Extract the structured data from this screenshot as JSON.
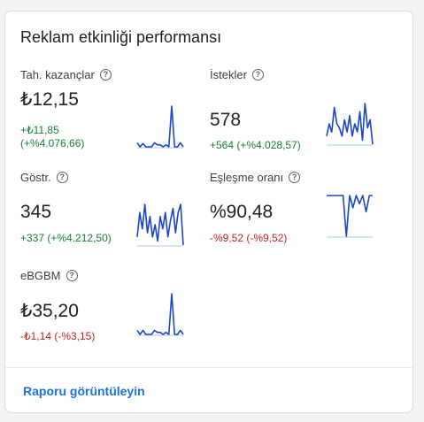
{
  "card": {
    "title": "Reklam etkinliği performansı",
    "footer_link": "Raporu görüntüleyin"
  },
  "help_glyph": "?",
  "metrics": [
    {
      "label": "Tah. kazançlar",
      "value": "₺12,15",
      "change_line1": "+₺11,85",
      "change_line2": "(+%4.076,66)",
      "trend": "positive"
    },
    {
      "label": "İstekler",
      "value": "578",
      "change_line1": "+564 (+%4.028,57)",
      "change_line2": "",
      "trend": "positive"
    },
    {
      "label": "Göstr.",
      "value": "345",
      "change_line1": "+337 (+%4.212,50)",
      "change_line2": "",
      "trend": "positive"
    },
    {
      "label": "Eşleşme oranı",
      "value": "%90,48",
      "change_line1": "-%9,52 (-%9,52)",
      "change_line2": "",
      "trend": "negative"
    },
    {
      "label": "eBGBM",
      "value": "₺35,20",
      "change_line1": "-₺1,14 (-%3,15)",
      "change_line2": "",
      "trend": "negative"
    }
  ],
  "colors": {
    "positive": "#188038",
    "negative": "#c5221f",
    "link": "#1a73e8",
    "sparkline": "#1a46c9",
    "baseline": "#aecbfa"
  },
  "sparklines": {
    "earnings": [
      0.1,
      0.0,
      0.08,
      0.0,
      0.0,
      0.0,
      0.1,
      0.05,
      0.05,
      0.0,
      0.05,
      0.0,
      1.0,
      0.0,
      0.0,
      0.1,
      0.0
    ],
    "requests": [
      0.2,
      0.5,
      0.3,
      0.9,
      0.5,
      0.4,
      0.2,
      0.6,
      0.3,
      0.7,
      0.2,
      0.5,
      0.3,
      0.8,
      0.1,
      1.0,
      0.4,
      0.6,
      0.0
    ],
    "impressions": [
      0.2,
      0.8,
      0.4,
      1.0,
      0.3,
      0.7,
      0.2,
      0.5,
      0.1,
      0.7,
      0.4,
      0.8,
      0.2,
      0.6,
      0.9,
      0.3,
      0.8,
      1.0,
      0.0
    ],
    "match_rate": [
      1.0,
      1.0,
      1.0,
      1.0,
      1.0,
      1.0,
      0.0,
      1.0,
      0.7,
      1.0,
      0.8,
      1.0,
      0.6,
      1.0,
      1.0
    ],
    "ebgbm": [
      0.1,
      0.0,
      0.1,
      0.0,
      0.0,
      0.0,
      0.1,
      0.05,
      0.05,
      0.0,
      0.05,
      0.0,
      1.0,
      0.0,
      0.0,
      0.1,
      0.0
    ]
  }
}
